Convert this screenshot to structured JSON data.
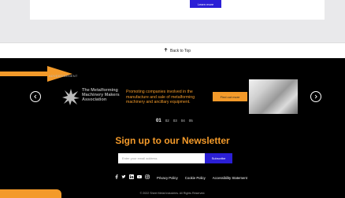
{
  "top": {
    "learn_more": "Learn more"
  },
  "back_to_top": {
    "icon": "arrow-up-icon",
    "label": "Back to Top"
  },
  "ad": {
    "label": "ADVERTISEMENT",
    "logo_line1": "The Metalforming",
    "logo_line2": "Machinery Makers",
    "logo_line3": "Association",
    "text": "Promoting companies involved in the manufacture and sale of metalforming machinery and ancillary equipment.",
    "button": "Find out more",
    "prev_icon": "chevron-left-icon",
    "next_icon": "chevron-right-icon"
  },
  "pager": [
    "01",
    "02",
    "03",
    "04",
    "05"
  ],
  "newsletter": {
    "title": "Sign up to our Newsletter",
    "placeholder": "Enter your email address",
    "button": "Subscribe"
  },
  "social_icons": [
    "facebook-icon",
    "twitter-icon",
    "linkedin-icon",
    "youtube-icon",
    "instagram-icon"
  ],
  "links": [
    "Privacy Policy",
    "Cookie Policy",
    "Accessibility Statement"
  ],
  "copyright": "© 2022 Sheet Metal Industries. All Rights Reserved.",
  "colors": {
    "accent_orange": "#f39a2a",
    "button_blue": "#2b1fd6",
    "footer_bg": "#000000"
  }
}
